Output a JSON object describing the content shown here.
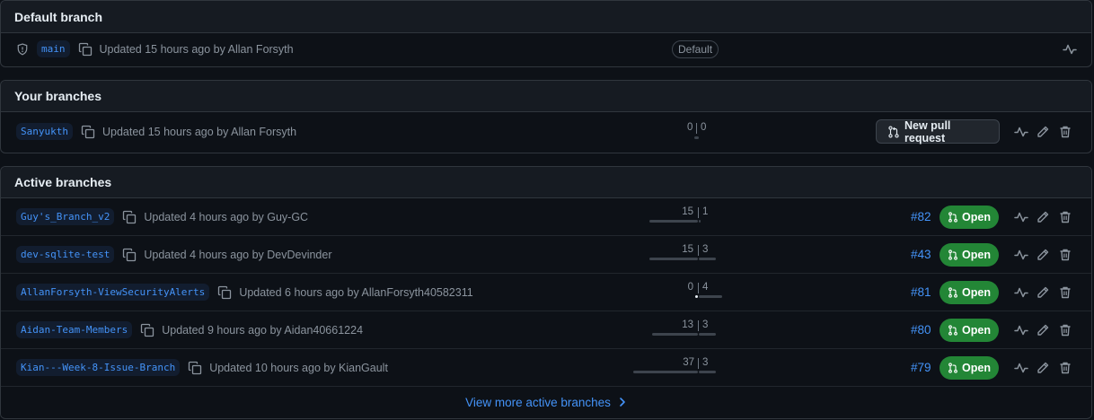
{
  "default_section": {
    "title": "Default branch",
    "branch": {
      "name": "main",
      "meta": "Updated 15 hours ago by Allan Forsyth",
      "badge": "Default"
    }
  },
  "your_section": {
    "title": "Your branches",
    "branch": {
      "name": "Sanyukth",
      "meta": "Updated 15 hours ago by Allan Forsyth",
      "behind": "0",
      "ahead": "0",
      "new_pr_label": "New pull request"
    }
  },
  "active_section": {
    "title": "Active branches",
    "branches": [
      {
        "name": "Guy's_Branch_v2",
        "meta": "Updated 4 hours ago by Guy-GC",
        "behind": "15",
        "ahead": "1",
        "pr": "#82",
        "status": "Open"
      },
      {
        "name": "dev-sqlite-test",
        "meta": "Updated 4 hours ago by DevDevinder",
        "behind": "15",
        "ahead": "3",
        "pr": "#43",
        "status": "Open"
      },
      {
        "name": "AllanForsyth-ViewSecurityAlerts",
        "meta": "Updated 6 hours ago by AllanForsyth40582311",
        "behind": "0",
        "ahead": "4",
        "pr": "#81",
        "status": "Open"
      },
      {
        "name": "Aidan-Team-Members",
        "meta": "Updated 9 hours ago by Aidan40661224",
        "behind": "13",
        "ahead": "3",
        "pr": "#80",
        "status": "Open"
      },
      {
        "name": "Kian---Week-8-Issue-Branch",
        "meta": "Updated 10 hours ago by KianGault",
        "behind": "37",
        "ahead": "3",
        "pr": "#79",
        "status": "Open"
      }
    ],
    "view_more": "View more active branches"
  },
  "colors": {
    "accent": "#4493f8",
    "open_green": "#238636",
    "border": "#30363d",
    "header_bg": "#161b22"
  }
}
